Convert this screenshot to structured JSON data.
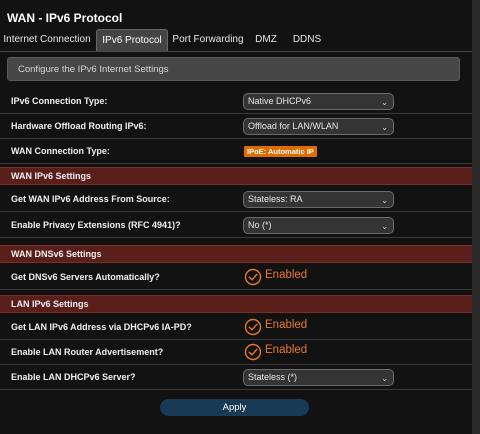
{
  "title": "WAN - IPv6 Protocol",
  "tabs": [
    "Internet Connection",
    "IPv6 Protocol",
    "Port Forwarding",
    "DMZ",
    "DDNS"
  ],
  "active_tab": "IPv6 Protocol",
  "config_bar": "Configure the IPv6 Internet Settings",
  "general": {
    "connection_type_label": "IPv6 Connection Type:",
    "connection_type_value": "Native DHCPv6",
    "offload_label": "Hardware Offload Routing IPv6:",
    "offload_value": "Offload for LAN/WLAN",
    "wan_conn_type_label": "WAN Connection Type:",
    "wan_conn_type_badge": "IPoE: Automatic IP"
  },
  "wan_ipv6": {
    "section_title": "WAN IPv6 Settings",
    "source_label": "Get WAN IPv6 Address From Source:",
    "source_value": "Stateless: RA",
    "privacy_label": "Enable Privacy Extensions (RFC 4941)?",
    "privacy_value": "No (*)"
  },
  "wan_dns": {
    "section_title": "WAN DNSv6 Settings",
    "auto_label": "Get DNSv6 Servers Automatically?",
    "auto_value": "Enabled"
  },
  "lan_ipv6": {
    "section_title": "LAN IPv6 Settings",
    "pd_label": "Get LAN IPv6 Address via DHCPv6 IA-PD?",
    "pd_value": "Enabled",
    "ra_label": "Enable LAN Router Advertisement?",
    "ra_value": "Enabled",
    "dhcp_label": "Enable LAN DHCPv6 Server?",
    "dhcp_value": "Stateless (*)"
  },
  "apply_label": "Apply",
  "icons": {
    "select": "chevron-down-icon",
    "enabled": "check-circle-icon"
  },
  "colors": {
    "accent": "#e8782a",
    "section_bg": "#5a1f1b",
    "badge": "#e06c00",
    "button": "#193a55"
  }
}
